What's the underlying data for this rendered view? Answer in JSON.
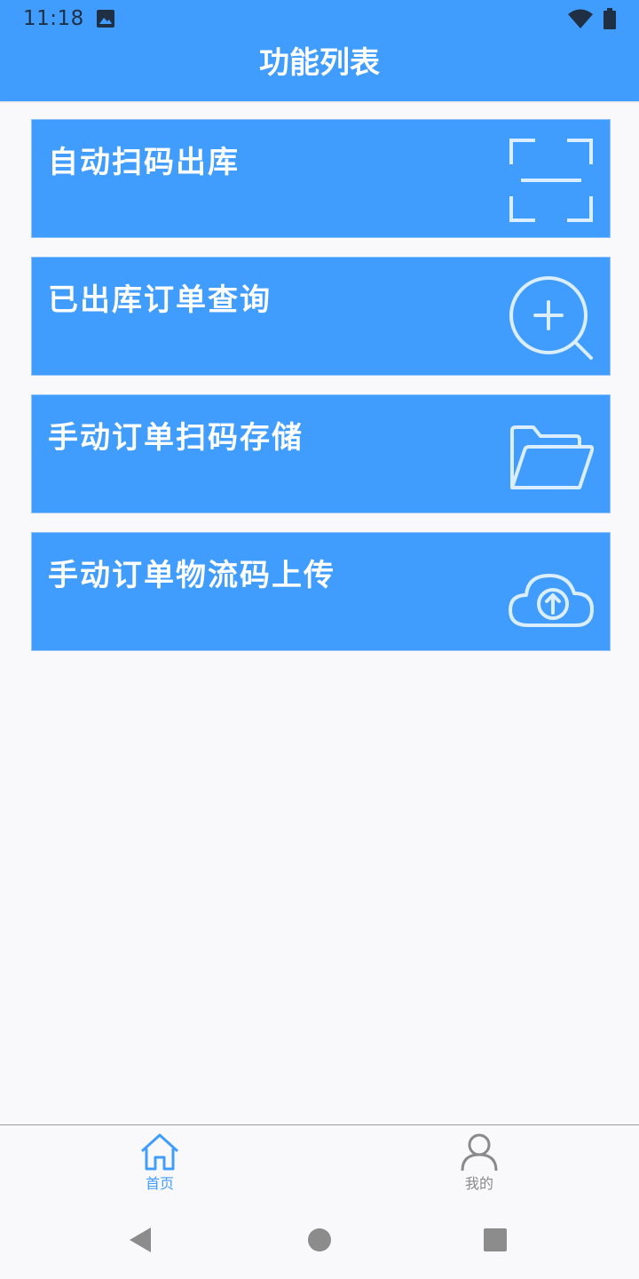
{
  "status_bar": {
    "time": "11:18",
    "icons": [
      "image-icon",
      "wifi-icon",
      "battery-icon"
    ]
  },
  "header": {
    "title": "功能列表"
  },
  "menu": {
    "items": [
      {
        "label": "自动扫码出库",
        "icon": "scan-icon"
      },
      {
        "label": "已出库订单查询",
        "icon": "zoom-in-icon"
      },
      {
        "label": "手动订单扫码存储",
        "icon": "folder-open-icon"
      },
      {
        "label": "手动订单物流码上传",
        "icon": "cloud-upload-icon"
      }
    ]
  },
  "bottom_nav": {
    "tabs": [
      {
        "label": "首页",
        "icon": "home-icon",
        "active": true
      },
      {
        "label": "我的",
        "icon": "user-icon",
        "active": false
      }
    ]
  },
  "system_nav": {
    "buttons": [
      "back-icon",
      "home-circle-icon",
      "recents-icon"
    ]
  },
  "colors": {
    "primary": "#419dfd",
    "card_border": "#8ec4fb",
    "icon_light": "#dbeeff",
    "background": "#f9f9fb",
    "tab_active": "#419dfd",
    "tab_inactive": "#8a8a8a",
    "system_nav": "#8c8c8c"
  }
}
